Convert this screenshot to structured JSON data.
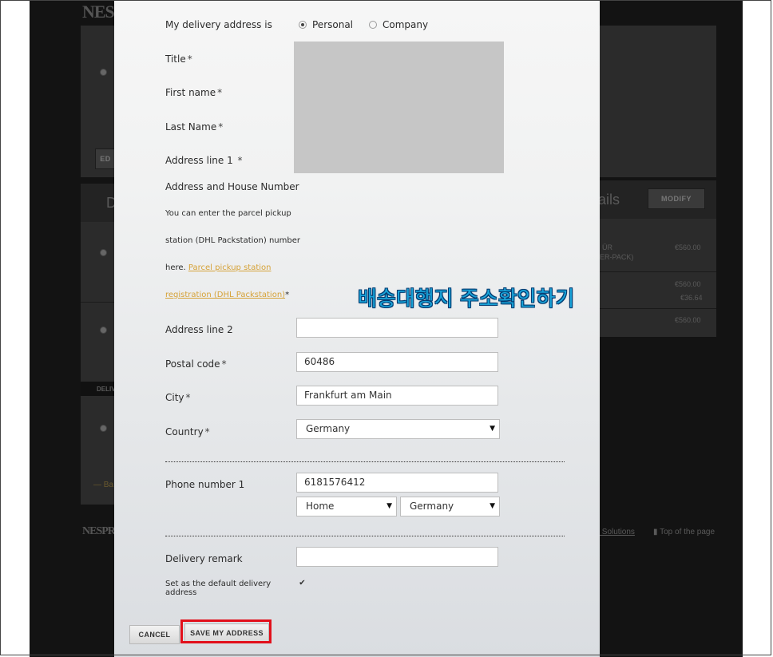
{
  "background": {
    "logo_top": "NES",
    "logo_bottom": "NESPR",
    "modify_button": "MODIFY",
    "heading_fragment": "ails",
    "heading_left": "D",
    "edit_button_fragment": "ED",
    "delivery_tab_fragment": "DELIV",
    "back_link_fragment": "Ba",
    "product_line_1": "ÜR",
    "product_line_2": "ER-PACK)",
    "prices": [
      "€560.00",
      "€560.00",
      "€36.64",
      "€560.00"
    ],
    "footer_link": "s Solutions",
    "top_of_page": "Top of the page"
  },
  "form": {
    "delivery_address_label": "My delivery address is",
    "address_type_options": [
      "Personal",
      "Company"
    ],
    "address_type_selected": "Personal",
    "title_label": "Title",
    "first_name_label": "First name",
    "last_name_label": "Last Name",
    "address_line1_label": "Address line 1 ",
    "address_line1_hint_title": "Address and House Number",
    "address_line1_hint_lines": [
      "You can enter the parcel pickup",
      "station (DHL Packstation) number",
      "here."
    ],
    "packstation_link_line1": "Parcel pickup station",
    "packstation_link_line2": "registration (DHL Packstation)",
    "required_mark": "*",
    "address_line2_label": "Address line 2",
    "address_line2_value": "",
    "postal_code_label": "Postal code",
    "postal_code_value": "60486",
    "city_label": "City",
    "city_value": "Frankfurt am Main",
    "country_label": "Country",
    "country_value": "Germany",
    "phone_label": "Phone number 1",
    "phone_value": "6181576412",
    "phone_type_value": "Home",
    "phone_country_value": "Germany",
    "delivery_remark_label": "Delivery remark",
    "delivery_remark_value": "",
    "default_address_label": "Set as the default delivery address",
    "default_address_checked": true,
    "checkbox_glyph": "✔",
    "select_arrow": "▼"
  },
  "actions": {
    "cancel_label": "CANCEL",
    "save_label": "SAVE MY ADDRESS"
  },
  "annotation": {
    "overlay_text": "배송대행지 주소확인하기",
    "highlight_color": "#e2101b",
    "overlay_color": "#1aa3d8"
  }
}
